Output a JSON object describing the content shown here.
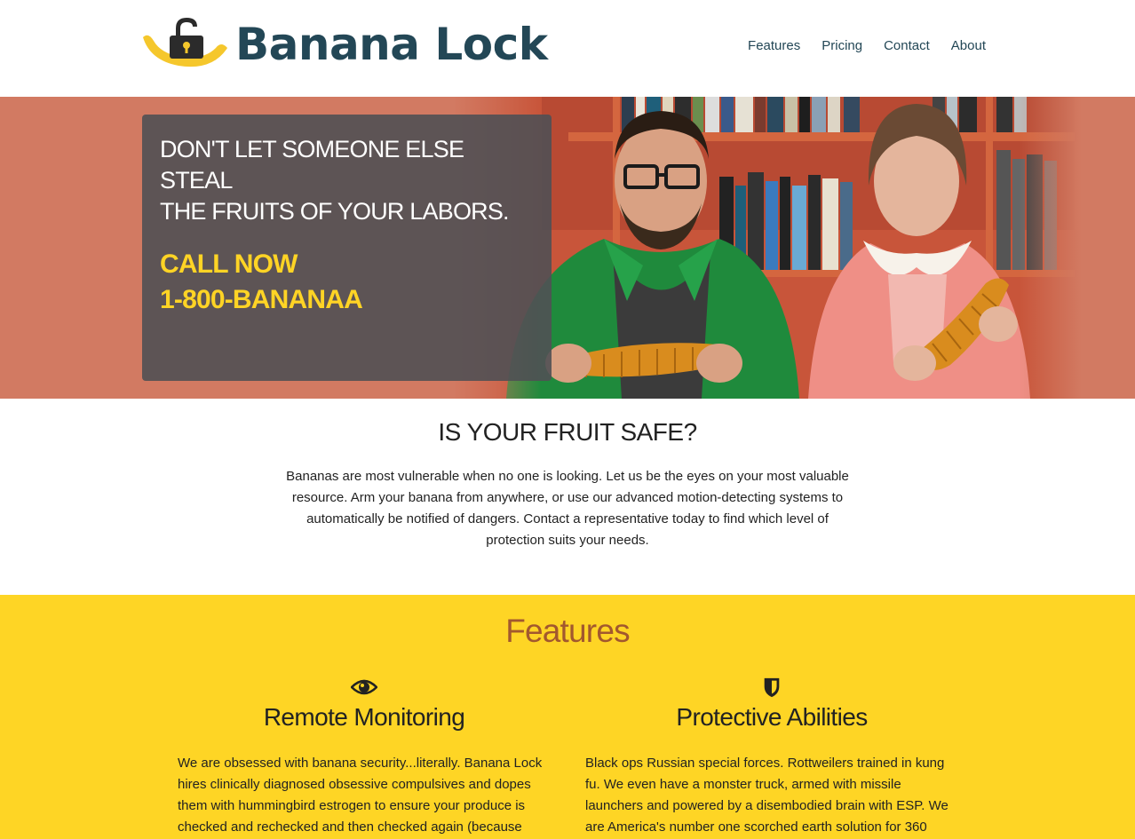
{
  "header": {
    "brand": "Banana Lock",
    "nav": [
      "Features",
      "Pricing",
      "Contact",
      "About"
    ]
  },
  "hero": {
    "headline_line1": "DON'T LET SOMEONE ELSE STEAL",
    "headline_line2": "THE FRUITS OF YOUR LABORS.",
    "cta_line1": "CALL NOW",
    "cta_line2": "1-800-BANANAA"
  },
  "intro": {
    "title": "IS YOUR FRUIT SAFE?",
    "body": "Bananas are most vulnerable when no one is looking. Let us be the eyes on your most valuable resource. Arm your banana from anywhere, or use our advanced motion-detecting systems to automatically be notified of dangers. Contact a representative today to find which level of protection suits your needs."
  },
  "features": {
    "title": "Features",
    "items": [
      {
        "icon": "eye-icon",
        "title": "Remote Monitoring",
        "body": "We are obsessed with banana security...literally. Banana Lock hires clinically diagnosed obsessive compulsives and dopes them with hummingbird estrogen to ensure your produce is checked and rechecked and then checked again (because"
      },
      {
        "icon": "shield-icon",
        "title": "Protective Abilities",
        "body": "Black ops Russian special forces. Rottweilers trained in kung fu. We even have a monster truck, armed with missile launchers and powered by a disembodied brain with ESP. We are America's number one scorched earth solution for 360"
      }
    ]
  },
  "colors": {
    "brand": "#234756",
    "hero_bg": "#d27a62",
    "cta": "#ffd425",
    "features_bg": "#fed525",
    "features_title": "#a2582e"
  }
}
